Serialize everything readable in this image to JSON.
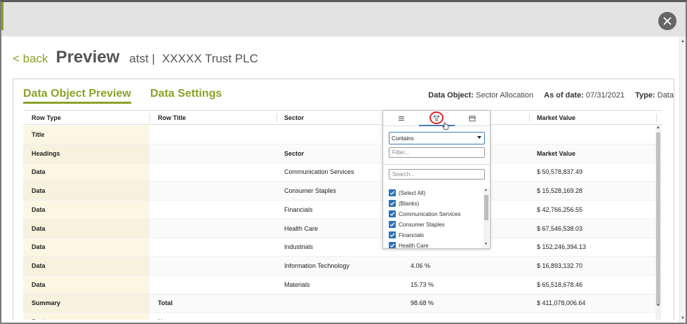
{
  "header": {
    "back_label": "< back",
    "title": "Preview",
    "subtitle_left": "atst |",
    "subtitle_right": "XXXXX  Trust PLC"
  },
  "tabs": [
    {
      "label": "Data Object Preview",
      "active": true
    },
    {
      "label": "Data Settings",
      "active": false
    }
  ],
  "meta": {
    "data_object_label": "Data Object:",
    "data_object_value": "Sector Allocation",
    "as_of_label": "As of date:",
    "as_of_value": "07/31/2021",
    "type_label": "Type:",
    "type_value": "Data"
  },
  "grid": {
    "columns": [
      "Row Type",
      "Row Title",
      "Sector",
      "",
      "Market Value"
    ],
    "rows": [
      {
        "type": "Title",
        "title": "",
        "sector": "",
        "pct": "",
        "value": ""
      },
      {
        "type": "Headings",
        "title": "",
        "sector": "Sector",
        "pct": "",
        "value": "Market Value"
      },
      {
        "type": "Data",
        "title": "",
        "sector": "Communication Services",
        "pct": "",
        "value": "$ 50,578,837.49"
      },
      {
        "type": "Data",
        "title": "",
        "sector": "Consumer Staples",
        "pct": "",
        "value": "$ 15,528,169.28"
      },
      {
        "type": "Data",
        "title": "",
        "sector": "Financials",
        "pct": "",
        "value": "$ 42,766,256.55"
      },
      {
        "type": "Data",
        "title": "",
        "sector": "Health Care",
        "pct": "",
        "value": "$ 67,546,538.03"
      },
      {
        "type": "Data",
        "title": "",
        "sector": "Industrials",
        "pct": "",
        "value": "$ 152,246,394.13"
      },
      {
        "type": "Data",
        "title": "",
        "sector": "Information Technology",
        "pct": "4.06 %",
        "value": "$ 16,893,132.70"
      },
      {
        "type": "Data",
        "title": "",
        "sector": "Materials",
        "pct": "15.73 %",
        "value": "$ 65,518,678.46"
      },
      {
        "type": "Summary",
        "title": "Total",
        "sector": "",
        "pct": "98.68 %",
        "value": "$ 411,078,006.64"
      },
      {
        "type": "Footer",
        "title": "Name",
        "sector": "",
        "pct": "",
        "value": ""
      }
    ]
  },
  "filter_menu": {
    "operator": "Contains",
    "filter_placeholder": "Filter...",
    "search_placeholder": "Search...",
    "options": [
      {
        "label": "(Select All)",
        "checked": true
      },
      {
        "label": "(Blanks)",
        "checked": true
      },
      {
        "label": "Communication Services",
        "checked": true
      },
      {
        "label": "Consumer Staples",
        "checked": true
      },
      {
        "label": "Financials",
        "checked": true
      },
      {
        "label": "Health Care",
        "checked": true
      }
    ]
  },
  "icons": {
    "close": "close-icon",
    "menu": "hamburger-icon",
    "filter": "funnel-icon",
    "columns": "columns-icon",
    "check": "check-icon"
  },
  "colors": {
    "accent_green": "#8aa32a",
    "checkbox_blue": "#2b73b7",
    "highlight_red": "#e0242a",
    "rowtype_bg": "#fbf7e3"
  }
}
